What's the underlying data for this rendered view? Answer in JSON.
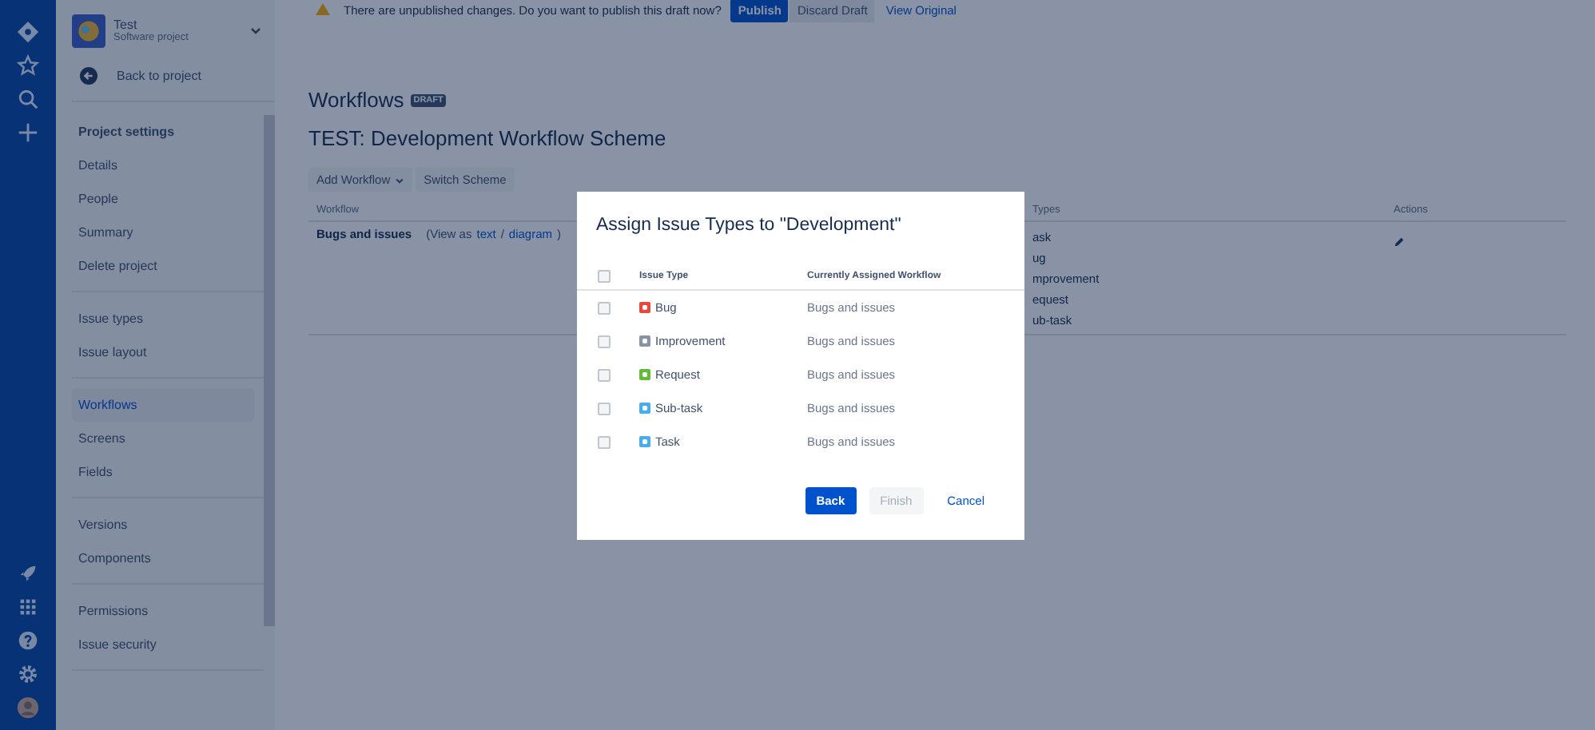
{
  "global_nav": {
    "items": [
      {
        "kind": "logo"
      },
      {
        "kind": "star"
      },
      {
        "kind": "search"
      },
      {
        "kind": "create"
      }
    ],
    "bottom_items": [
      {
        "kind": "rocket"
      },
      {
        "kind": "apps"
      },
      {
        "kind": "help"
      },
      {
        "kind": "settings"
      },
      {
        "kind": "avatar"
      }
    ]
  },
  "sidebar": {
    "project_name": "Test",
    "project_type": "Software project",
    "back_link": "Back to project",
    "groups": [
      {
        "title": "Project settings",
        "items": [
          {
            "label": "Details",
            "selected": false
          },
          {
            "label": "People",
            "selected": false
          },
          {
            "label": "Summary",
            "selected": false
          },
          {
            "label": "Delete project",
            "selected": false
          }
        ]
      },
      {
        "items": [
          {
            "label": "Issue types",
            "selected": false
          },
          {
            "label": "Issue layout",
            "selected": false
          }
        ]
      },
      {
        "items": [
          {
            "label": "Workflows",
            "selected": true
          },
          {
            "label": "Screens",
            "selected": false
          },
          {
            "label": "Fields",
            "selected": false
          }
        ]
      },
      {
        "items": [
          {
            "label": "Versions",
            "selected": false
          },
          {
            "label": "Components",
            "selected": false
          }
        ]
      },
      {
        "items": [
          {
            "label": "Permissions",
            "selected": false
          },
          {
            "label": "Issue security",
            "selected": false
          }
        ]
      }
    ]
  },
  "banner": {
    "message": "There are unpublished changes. Do you want to publish this draft now?",
    "publish": "Publish",
    "discard": "Discard Draft",
    "view_original": "View Original"
  },
  "page": {
    "title": "Workflows",
    "badge": "DRAFT",
    "subtitle": "TEST: Development Workflow Scheme",
    "toolbar": {
      "add": "Add Workflow",
      "switch": "Switch Scheme"
    },
    "table": {
      "columns": [
        "Workflow",
        "Types",
        "Actions"
      ],
      "rows": [
        {
          "workflow": "Bugs and issues",
          "view_prefix": "(View as",
          "text_link": "text",
          "separator": "/",
          "diagram_link": "diagram",
          "view_suffix": ")",
          "issue_types": [
            "ask",
            "ug",
            "mprovement",
            "equest",
            "ub-task"
          ]
        }
      ]
    }
  },
  "dialog": {
    "title": "Assign Issue Types to \"Development\"",
    "header_checked": false,
    "columns": [
      "Issue Type",
      "Currently Assigned Workflow"
    ],
    "rows": [
      {
        "issue_type": "Bug",
        "color": "#e5493a",
        "workflow": "Bugs and issues",
        "checked": false
      },
      {
        "issue_type": "Improvement",
        "color": "#8993a4",
        "workflow": "Bugs and issues",
        "checked": false
      },
      {
        "issue_type": "Request",
        "color": "#63ba3c",
        "workflow": "Bugs and issues",
        "checked": false
      },
      {
        "issue_type": "Sub-task",
        "color": "#4bade8",
        "workflow": "Bugs and issues",
        "checked": false
      },
      {
        "issue_type": "Task",
        "color": "#4bade8",
        "workflow": "Bugs and issues",
        "checked": false
      }
    ],
    "buttons": [
      {
        "label": "Back",
        "kind": "primary",
        "disabled": false
      },
      {
        "label": "Finish",
        "kind": "default",
        "disabled": true
      },
      {
        "label": "Cancel",
        "kind": "link",
        "disabled": false
      }
    ]
  }
}
